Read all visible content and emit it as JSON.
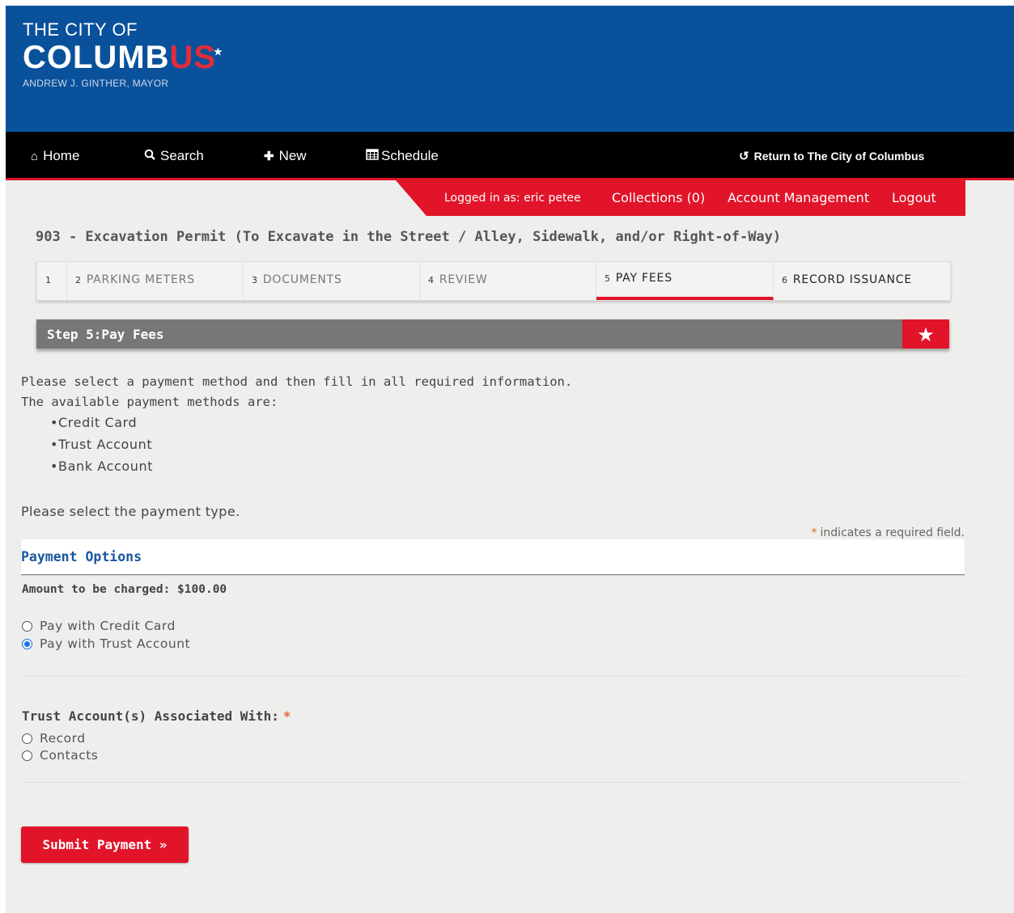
{
  "brand": {
    "line1": "THE CITY OF",
    "line2_main": "COLUMB",
    "line2_accent": "US",
    "mayor": "ANDREW J. GINTHER, MAYOR",
    "primary_color": "#0a519b",
    "accent_color": "#e1142a"
  },
  "nav": {
    "home": "Home",
    "search": "Search",
    "new": "New",
    "schedule": "Schedule",
    "return": "Return to The City of Columbus"
  },
  "userbar": {
    "logged_in": "Logged in as: eric petee",
    "collections": "Collections (0)",
    "account": "Account Management",
    "logout": "Logout"
  },
  "page_title": "903 - Excavation Permit (To Excavate in the Street / Alley, Sidewalk, and/or Right-of-Way)",
  "steps": [
    {
      "num": "1",
      "label": ""
    },
    {
      "num": "2",
      "label": "PARKING METERS"
    },
    {
      "num": "3",
      "label": "DOCUMENTS"
    },
    {
      "num": "4",
      "label": "REVIEW"
    },
    {
      "num": "5",
      "label": "PAY FEES"
    },
    {
      "num": "6",
      "label": "RECORD ISSUANCE"
    }
  ],
  "step_bar": {
    "label": "Step 5:Pay Fees",
    "icon": "star-icon"
  },
  "intro": {
    "line1": "Please select a payment method and then fill in all required information.",
    "line2": "The available payment methods are:",
    "methods": [
      "•Credit Card",
      "•Trust Account",
      "•Bank Account"
    ],
    "select_type": "Please select the payment type."
  },
  "required_note": {
    "asterisk": "*",
    "text": "indicates a required field."
  },
  "payment_options": {
    "title": "Payment Options",
    "amount": "Amount to be charged: $100.00",
    "options": [
      {
        "label": "Pay with Credit Card",
        "checked": false
      },
      {
        "label": "Pay with Trust Account",
        "checked": true
      }
    ]
  },
  "trust": {
    "label": "Trust Account(s) Associated With:",
    "asterisk": "*",
    "options": [
      {
        "label": "Record",
        "checked": false
      },
      {
        "label": "Contacts",
        "checked": false
      }
    ]
  },
  "submit": "Submit Payment »"
}
